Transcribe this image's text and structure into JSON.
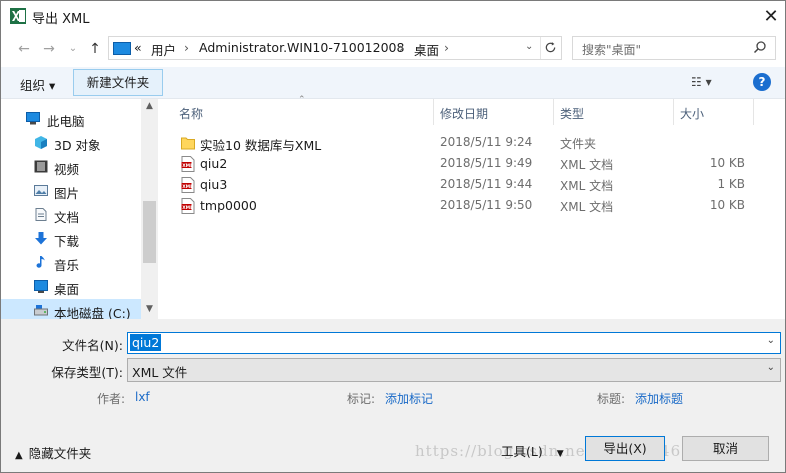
{
  "window": {
    "title": "导出 XML"
  },
  "address": {
    "segments": [
      "«",
      "用户",
      "Administrator.WIN10-710012008",
      "桌面"
    ],
    "seps": [
      "›",
      "›",
      "›"
    ]
  },
  "search": {
    "placeholder": "搜索\"桌面\""
  },
  "toolbar": {
    "organize": "组织 ▾",
    "new_folder": "新建文件夹",
    "view": "☷ ▾"
  },
  "sidebar": {
    "items": [
      {
        "label": "此电脑",
        "icon": "computer-icon"
      },
      {
        "label": "3D 对象",
        "icon": "3d-objects-icon"
      },
      {
        "label": "视频",
        "icon": "video-icon"
      },
      {
        "label": "图片",
        "icon": "pictures-icon"
      },
      {
        "label": "文档",
        "icon": "documents-icon"
      },
      {
        "label": "下载",
        "icon": "downloads-icon"
      },
      {
        "label": "音乐",
        "icon": "music-icon"
      },
      {
        "label": "桌面",
        "icon": "desktop-icon"
      },
      {
        "label": "本地磁盘 (C:)",
        "icon": "disk-icon"
      }
    ]
  },
  "columns": {
    "name": "名称",
    "date": "修改日期",
    "type": "类型",
    "size": "大小"
  },
  "files": [
    {
      "name": "实验10 数据库与XML",
      "date": "2018/5/11 9:24",
      "type": "文件夹",
      "size": "",
      "icon": "folder-icon"
    },
    {
      "name": "qiu2",
      "date": "2018/5/11 9:49",
      "type": "XML 文档",
      "size": "10 KB",
      "icon": "xml-file-icon"
    },
    {
      "name": "qiu3",
      "date": "2018/5/11 9:44",
      "type": "XML 文档",
      "size": "1 KB",
      "icon": "xml-file-icon"
    },
    {
      "name": "tmp0000",
      "date": "2018/5/11 9:50",
      "type": "XML 文档",
      "size": "10 KB",
      "icon": "xml-file-icon"
    }
  ],
  "form": {
    "filename_label": "文件名(N):",
    "filename_value": "qiu2",
    "filetype_label": "保存类型(T):",
    "filetype_value": "XML 文件",
    "author_label": "作者:",
    "author_value": "lxf",
    "tags_label": "标记:",
    "tags_value": "添加标记",
    "title_label": "标题:",
    "title_value": "添加标题"
  },
  "footer": {
    "hide_folders": "隐藏文件夹",
    "tools": "工具(L)",
    "export": "导出(X)",
    "cancel": "取消",
    "watermark": "https://blog.csdn.net/qq_3894623"
  },
  "colors": {
    "accent": "#0078d7",
    "selection": "#cce8ff",
    "link": "#1a6ac7"
  }
}
